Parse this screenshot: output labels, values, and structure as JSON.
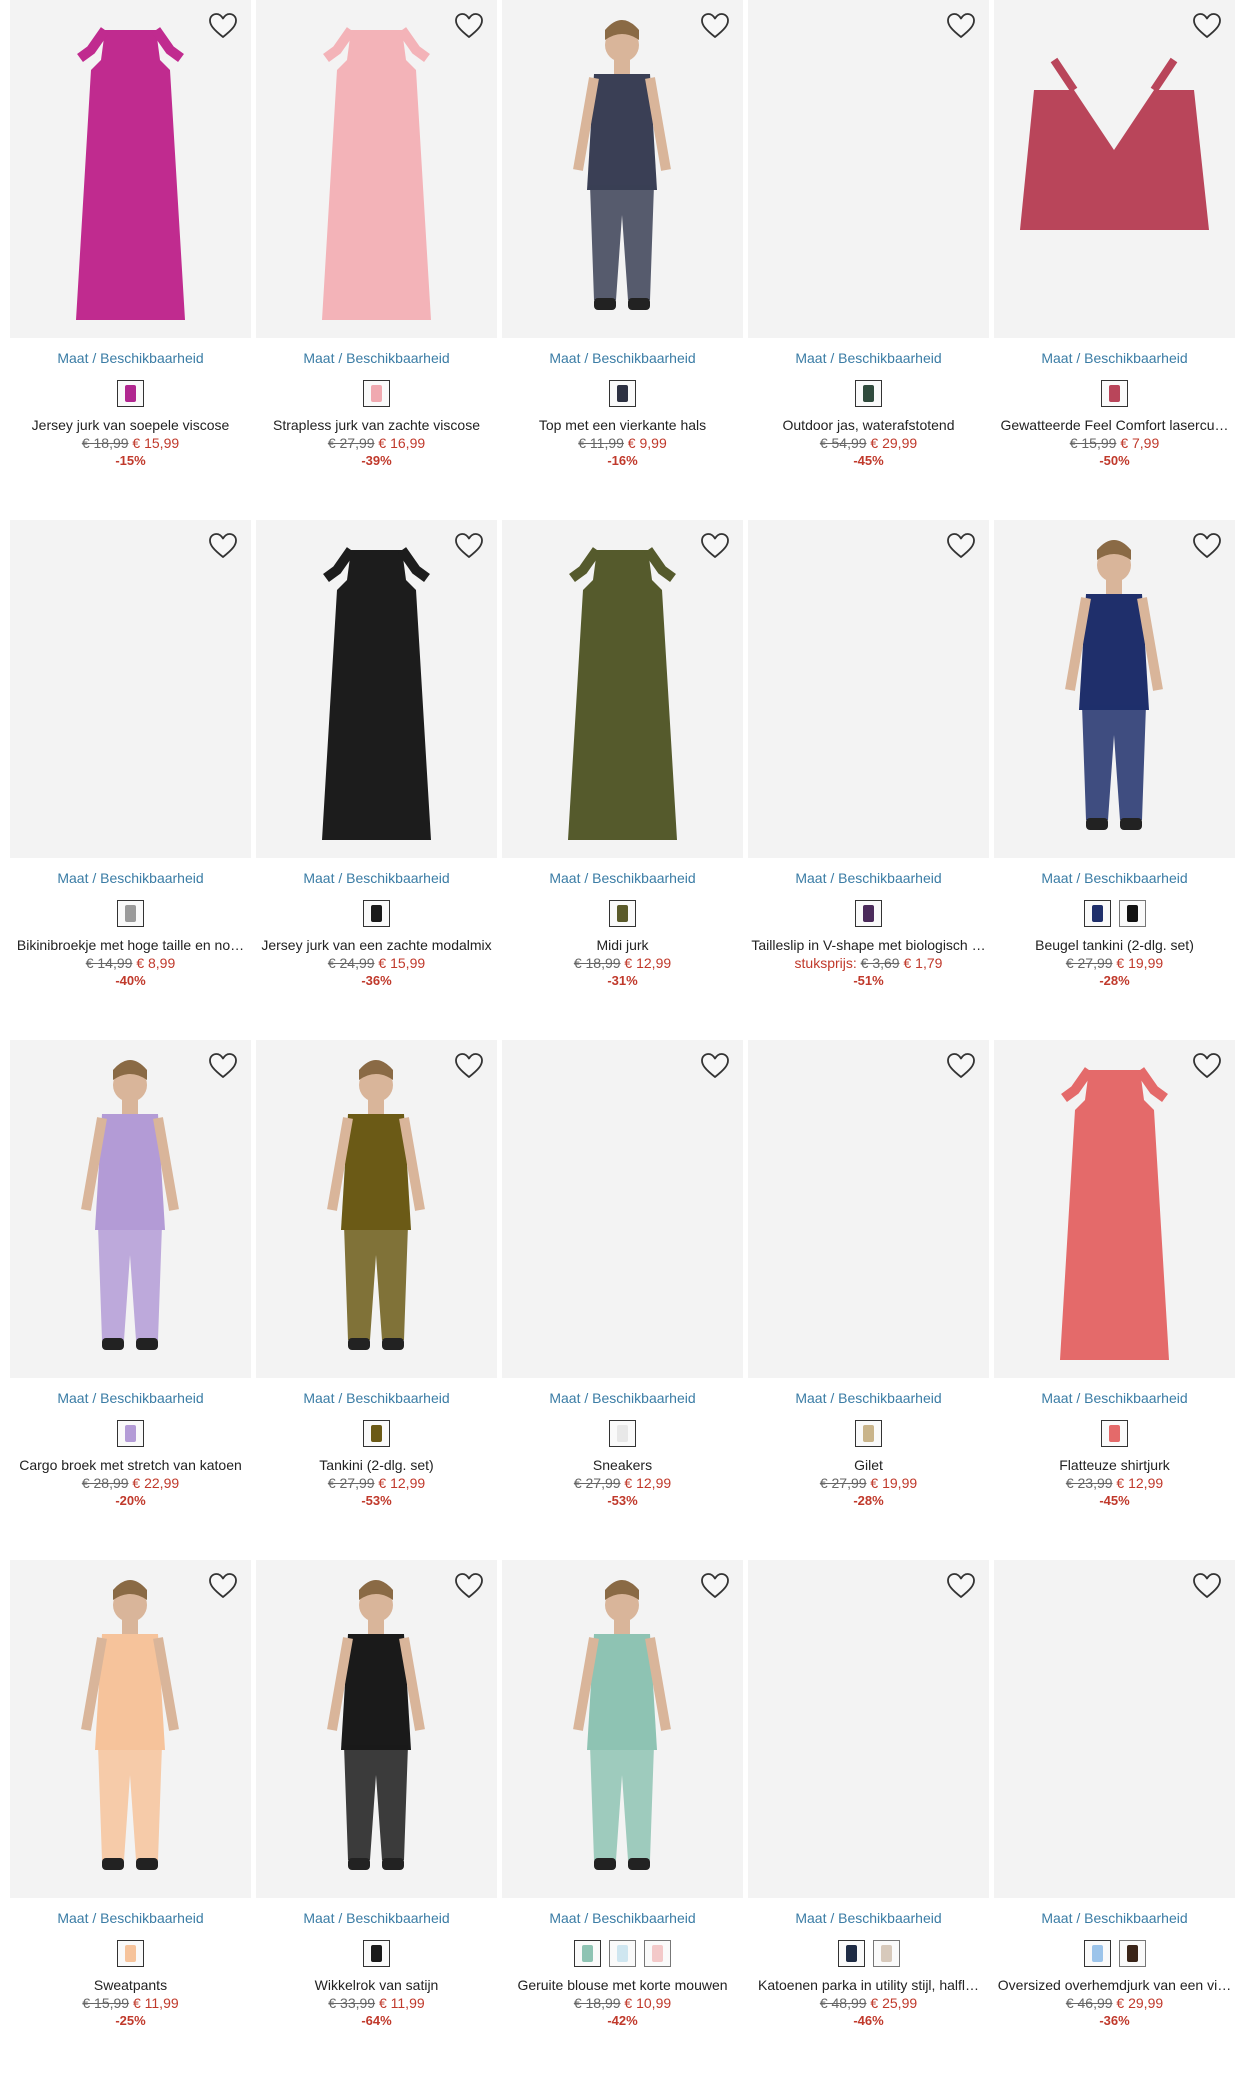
{
  "size_link_label": "Maat / Beschikbaarheid",
  "colors": {
    "link": "#3a7ca5",
    "sale": "#c0392b",
    "old_price": "#666666"
  },
  "products": [
    {
      "name": "Jersey jurk van soepele viscose",
      "old_price": "€ 18,99",
      "price": "€ 15,99",
      "discount": "-15%",
      "swatches": [
        "#b0268f"
      ],
      "photo": "#c02b8f",
      "figure": "dress"
    },
    {
      "name": "Strapless jurk van zachte viscose",
      "old_price": "€ 27,99",
      "price": "€ 16,99",
      "discount": "-39%",
      "swatches": [
        "#f0a9b0"
      ],
      "photo": "#f3b3b8",
      "figure": "dress"
    },
    {
      "name": "Top met een vierkante hals",
      "old_price": "€ 11,99",
      "price": "€ 9,99",
      "discount": "-16%",
      "swatches": [
        "#2d3142"
      ],
      "photo": "#3a3f55",
      "figure": "person"
    },
    {
      "name": "Outdoor jas, waterafstotend",
      "old_price": "€ 54,99",
      "price": "€ 29,99",
      "discount": "-45%",
      "swatches": [
        "#2f4a3c"
      ],
      "photo": "",
      "figure": "none"
    },
    {
      "name": "Gewatteerde Feel Comfort lasercu…",
      "old_price": "€ 15,99",
      "price": "€ 7,99",
      "discount": "-50%",
      "swatches": [
        "#b9455a"
      ],
      "photo": "#b9455a",
      "figure": "bra"
    },
    {
      "name": "Bikinibroekje met hoge taille en no…",
      "old_price": "€ 14,99",
      "price": "€ 8,99",
      "discount": "-40%",
      "swatches": [
        "#9a9a9a"
      ],
      "photo": "",
      "figure": "none"
    },
    {
      "name": "Jersey jurk van een zachte modalmix",
      "old_price": "€ 24,99",
      "price": "€ 15,99",
      "discount": "-36%",
      "swatches": [
        "#1a1a1a"
      ],
      "photo": "#1c1c1c",
      "figure": "dress"
    },
    {
      "name": "Midi jurk",
      "old_price": "€ 18,99",
      "price": "€ 12,99",
      "discount": "-31%",
      "swatches": [
        "#5a5a2a"
      ],
      "photo": "#555a2c",
      "figure": "dress"
    },
    {
      "name": "Tailleslip in V-shape met biologisch …",
      "unit_label": "stuksprijs:",
      "old_price": "€ 3,69",
      "price": "€ 1,79",
      "discount": "-51%",
      "swatches": [
        "#4a2a5a"
      ],
      "photo": "",
      "figure": "none"
    },
    {
      "name": "Beugel tankini (2-dlg. set)",
      "old_price": "€ 27,99",
      "price": "€ 19,99",
      "discount": "-28%",
      "swatches": [
        "#1f2f6b",
        "#111111"
      ],
      "photo": "#1f2f6b",
      "figure": "person"
    },
    {
      "name": "Cargo broek met stretch van katoen",
      "old_price": "€ 28,99",
      "price": "€ 22,99",
      "discount": "-20%",
      "swatches": [
        "#b39bd6"
      ],
      "photo": "#b39bd6",
      "figure": "person"
    },
    {
      "name": "Tankini (2-dlg. set)",
      "old_price": "€ 27,99",
      "price": "€ 12,99",
      "discount": "-53%",
      "swatches": [
        "#6b5a16"
      ],
      "photo": "#6b5a16",
      "figure": "person"
    },
    {
      "name": "Sneakers",
      "old_price": "€ 27,99",
      "price": "€ 12,99",
      "discount": "-53%",
      "swatches": [
        "#e8e8e8"
      ],
      "photo": "",
      "figure": "none"
    },
    {
      "name": "Gilet",
      "old_price": "€ 27,99",
      "price": "€ 19,99",
      "discount": "-28%",
      "swatches": [
        "#c9b48a"
      ],
      "photo": "",
      "figure": "none"
    },
    {
      "name": "Flatteuze shirtjurk",
      "old_price": "€ 23,99",
      "price": "€ 12,99",
      "discount": "-45%",
      "swatches": [
        "#e46a6a"
      ],
      "photo": "#e46a6a",
      "figure": "dress"
    },
    {
      "name": "Sweatpants",
      "old_price": "€ 15,99",
      "price": "€ 11,99",
      "discount": "-25%",
      "swatches": [
        "#f6c39b"
      ],
      "photo": "#f6c39b",
      "figure": "person"
    },
    {
      "name": "Wikkelrok van satijn",
      "old_price": "€ 33,99",
      "price": "€ 11,99",
      "discount": "-64%",
      "swatches": [
        "#1a1a1a"
      ],
      "photo": "#1a1a1a",
      "figure": "person"
    },
    {
      "name": "Geruite blouse met korte mouwen",
      "old_price": "€ 18,99",
      "price": "€ 10,99",
      "discount": "-42%",
      "swatches": [
        "#8ec3b3",
        "#cfe6f0",
        "#f3c9c9"
      ],
      "photo": "#8ec3b3",
      "figure": "person"
    },
    {
      "name": "Katoenen parka in utility stijl, halfl…",
      "old_price": "€ 48,99",
      "price": "€ 25,99",
      "discount": "-46%",
      "swatches": [
        "#1e2b44",
        "#d7c9bb"
      ],
      "photo": "",
      "figure": "none"
    },
    {
      "name": "Oversized overhemdjurk van een vi…",
      "old_price": "€ 46,99",
      "price": "€ 29,99",
      "discount": "-36%",
      "swatches": [
        "#9cc4ea",
        "#3a2418"
      ],
      "photo": "",
      "figure": "none"
    }
  ]
}
